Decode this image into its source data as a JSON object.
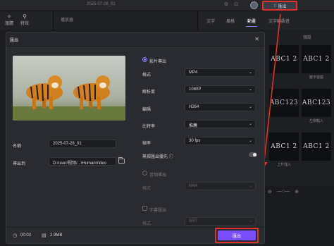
{
  "app": {
    "date_title": "2025-07-28_01",
    "export_button": "匯出",
    "left_tabs": [
      "滙題",
      "特效"
    ],
    "media_title": "播放器",
    "right_tabs": [
      "文字",
      "風格",
      "動畫",
      "文字轉語音"
    ],
    "right_subheader": "預設",
    "template_cards": [
      {
        "text": "ABC1 2",
        "label": ""
      },
      {
        "text": "ABC1 2",
        "label": "變字遊戲"
      },
      {
        "text": "ABC123",
        "label": ""
      },
      {
        "text": "ABC123",
        "label": "左側輸入"
      },
      {
        "text": "ABC1 2",
        "label": "上升插入"
      },
      {
        "text": "ABC1 2",
        "label": ""
      }
    ]
  },
  "dialog": {
    "title": "匯出",
    "name_label": "名稱",
    "name_value": "2025-07-28_01",
    "path_label": "導出到",
    "path_value": "D:/user/视频/...\\HumanVideo",
    "video_section": "影片導出",
    "rows": [
      {
        "label": "格式",
        "value": "MP4"
      },
      {
        "label": "解析度",
        "value": "1080P"
      },
      {
        "label": "編碼",
        "value": "H264"
      },
      {
        "label": "比特率",
        "value": "推薦"
      },
      {
        "label": "幀率",
        "value": "30 fps"
      }
    ],
    "lossless_label": "無損匯出優先",
    "lossless_info_icon": "ⓘ",
    "audio_section": "音頻導出",
    "audio_format_label": "格式",
    "audio_format_value": "M4A",
    "subtitle_section": "字幕匯出",
    "subtitle_format_label": "格式",
    "subtitle_format_value": "SRT",
    "duration": "00:03",
    "file_size": "2.9MB",
    "export_button": "匯出"
  },
  "colors": {
    "accent": "#7a4dff",
    "annotation": "#e0332b",
    "dialog_bg": "#2a2b30"
  }
}
